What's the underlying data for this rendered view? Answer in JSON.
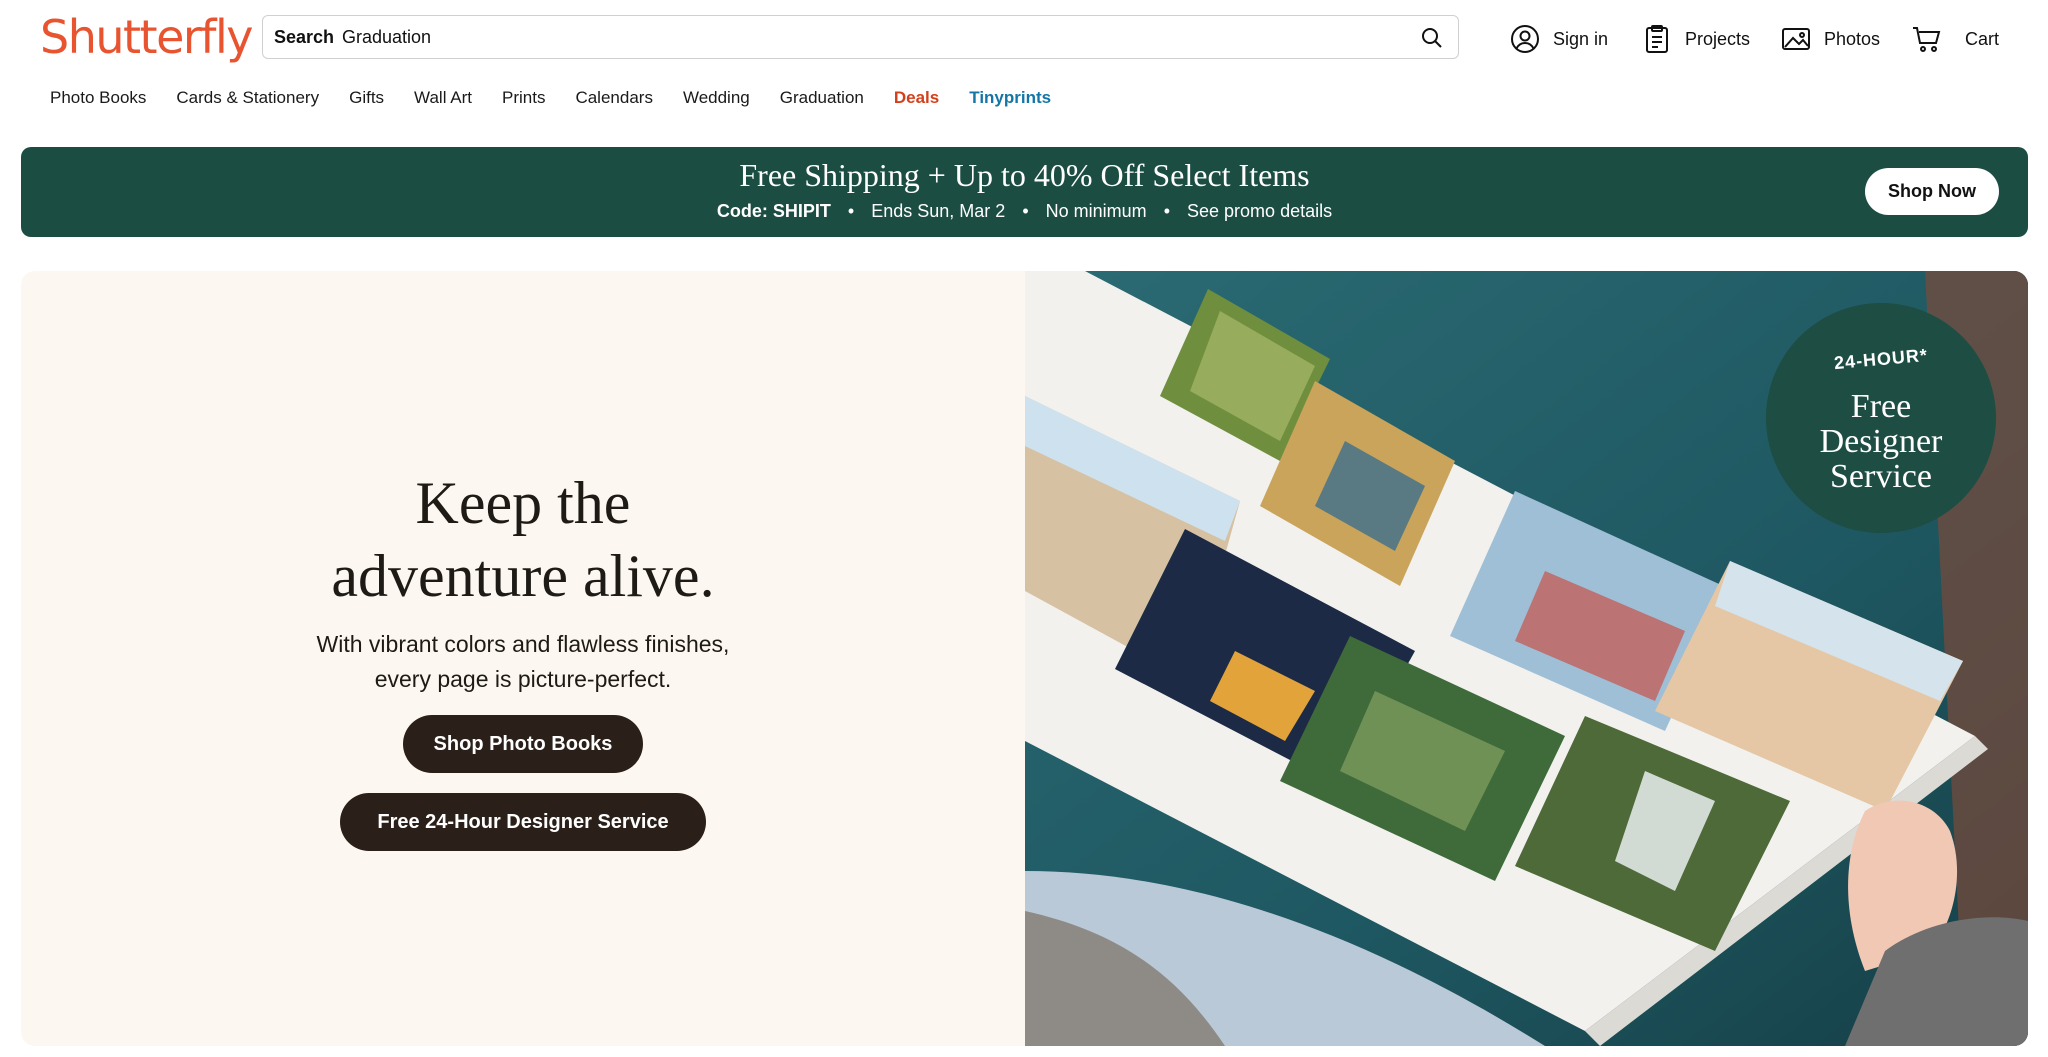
{
  "brand": {
    "logo_text": "Shutterfly",
    "logo_color": "#e8542f"
  },
  "search": {
    "label": "Search",
    "value": "Graduation",
    "icon": "search-icon"
  },
  "utility": [
    {
      "label": "Sign in",
      "icon": "user-circle-icon"
    },
    {
      "label": "Projects",
      "icon": "clipboard-icon"
    },
    {
      "label": "Photos",
      "icon": "image-icon"
    },
    {
      "label": "Cart",
      "icon": "cart-icon"
    }
  ],
  "nav": [
    {
      "label": "Photo Books"
    },
    {
      "label": "Cards & Stationery"
    },
    {
      "label": "Gifts"
    },
    {
      "label": "Wall Art"
    },
    {
      "label": "Prints"
    },
    {
      "label": "Calendars"
    },
    {
      "label": "Wedding"
    },
    {
      "label": "Graduation"
    },
    {
      "label": "Deals",
      "color": "#d3401b"
    },
    {
      "label": "Tinyprints",
      "color": "#1476a6"
    }
  ],
  "promo": {
    "title": "Free Shipping + Up to 40% Off Select Items",
    "code": "Code: SHIPIT",
    "ends": "Ends Sun, Mar 2",
    "minimum": "No minimum",
    "details": "See promo details",
    "separator": "•",
    "cta": "Shop Now",
    "background": "#1c4d42"
  },
  "hero": {
    "title_line1": "Keep the",
    "title_line2": "adventure alive.",
    "subtitle_line1": "With vibrant colors and flawless finishes,",
    "subtitle_line2": "every page is picture-perfect.",
    "cta_primary": "Shop Photo Books",
    "cta_secondary": "Free 24-Hour Designer Service",
    "badge_top": "24-HOUR*",
    "badge_line1": "Free",
    "badge_line2": "Designer",
    "badge_line3": "Service"
  }
}
